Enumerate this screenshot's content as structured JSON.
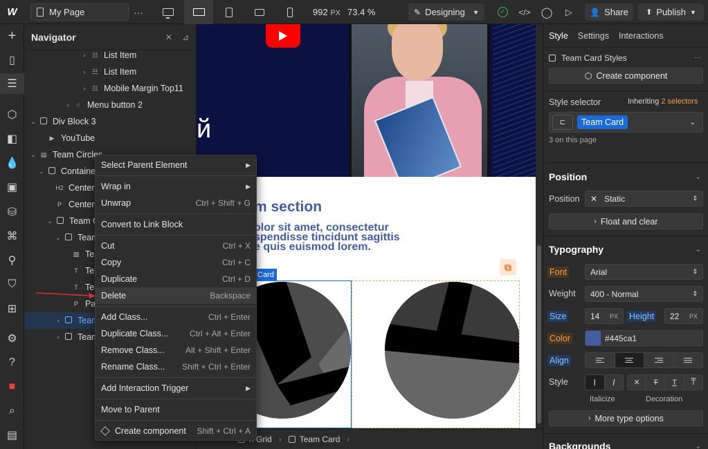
{
  "topbar": {
    "page_label": "My Page",
    "more": "···",
    "width": "992",
    "width_unit": "PX",
    "zoom": "73.4 %",
    "mode": "Designing",
    "share": "Share",
    "publish": "Publish"
  },
  "navigator": {
    "title": "Navigator",
    "rows": [
      {
        "label": "List Item"
      },
      {
        "label": "List Item"
      },
      {
        "label": "Mobile Margin Top11"
      },
      {
        "label": "Menu button 2"
      },
      {
        "label": "Div Block 3"
      },
      {
        "label": "YouTube"
      },
      {
        "label": "Team Circles"
      },
      {
        "label": "Container"
      },
      {
        "label": "Centere"
      },
      {
        "label": "Centere"
      },
      {
        "label": "Team Gr"
      },
      {
        "label": "Team"
      },
      {
        "label": "Tea"
      },
      {
        "label": "Tea"
      },
      {
        "label": "Tea"
      },
      {
        "label": "Par"
      },
      {
        "label": "Team"
      },
      {
        "label": "Team"
      }
    ],
    "tags": {
      "h2": "H2",
      "p": "P",
      "t": "T"
    }
  },
  "context_menu": {
    "items": [
      {
        "label": "Select Parent Element",
        "shortcut": ""
      },
      {
        "label": "Wrap in",
        "shortcut": ""
      },
      {
        "label": "Unwrap",
        "shortcut": "Ctrl + Shift + G"
      },
      {
        "label": "Convert to Link Block",
        "shortcut": ""
      },
      {
        "label": "Cut",
        "shortcut": "Ctrl + X"
      },
      {
        "label": "Copy",
        "shortcut": "Ctrl + C"
      },
      {
        "label": "Duplicate",
        "shortcut": "Ctrl + D"
      },
      {
        "label": "Delete",
        "shortcut": "Backspace"
      },
      {
        "label": "Add Class...",
        "shortcut": "Ctrl + Enter"
      },
      {
        "label": "Duplicate Class...",
        "shortcut": "Ctrl + Alt + Enter"
      },
      {
        "label": "Remove Class...",
        "shortcut": "Alt + Shift + Enter"
      },
      {
        "label": "Rename Class...",
        "shortcut": "Shift + Ctrl + Enter"
      },
      {
        "label": "Add Interaction Trigger",
        "shortcut": ""
      },
      {
        "label": "Move to Parent",
        "shortcut": ""
      },
      {
        "label": "Create component",
        "shortcut": "Shift + Ctrl + A"
      }
    ]
  },
  "canvas": {
    "hero_glyph": "й",
    "section_title": "m section",
    "section_text_1": "olor sit amet, consectetur",
    "section_text_2": "spendisse tincidunt sagittis",
    "section_text_3": "e quis euismod lorem.",
    "selected_tag": "Card"
  },
  "breadcrumb": {
    "items": [
      "n Grid",
      "Team Card"
    ]
  },
  "right_panel": {
    "tabs": [
      "Style",
      "Settings",
      "Interactions"
    ],
    "styles_label": "Team Card Styles",
    "create_component": "Create component",
    "style_selector": "Style selector",
    "inheriting": "Inheriting",
    "selectors_count": "2 selectors",
    "class_name": "Team Card",
    "on_page": "3 on this page",
    "position": {
      "heading": "Position",
      "label": "Position",
      "value": "Static",
      "float_btn": "Float and clear"
    },
    "typography": {
      "heading": "Typography",
      "font_label": "Font",
      "font_value": "Arial",
      "weight_label": "Weight",
      "weight_value": "400 - Normal",
      "size_label": "Size",
      "size_value": "14",
      "size_unit": "PX",
      "height_label": "Height",
      "height_value": "22",
      "height_unit": "PX",
      "color_label": "Color",
      "color_value": "#445ca1",
      "align_label": "Align",
      "style_label": "Style",
      "italicize": "Italicize",
      "decoration": "Decoration",
      "more_btn": "More type options"
    },
    "backgrounds_heading": "Backgrounds"
  },
  "colors": {
    "accent": "#1a6bd8",
    "text_color": "#445ca1",
    "hero_bg": "#0b1241",
    "status_ok": "#3cb371"
  }
}
